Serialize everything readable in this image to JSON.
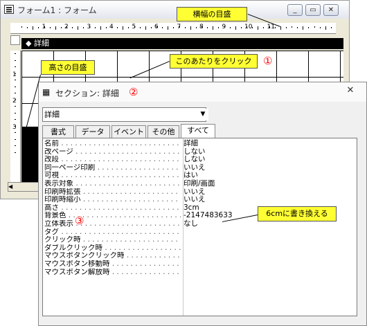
{
  "form_window": {
    "title": "フォーム1 : フォーム",
    "minimize": "_",
    "restore": "▭",
    "close": "✕",
    "ruler_digits": [
      "1",
      "2",
      "3",
      "4",
      "5",
      "6",
      "7",
      "8",
      "9",
      "10",
      "11"
    ],
    "vruler_digits": [
      "1",
      "2",
      "3"
    ],
    "section_label": "詳細"
  },
  "property_sheet": {
    "title": "セクション: 詳細",
    "close": "✕",
    "selector_value": "詳細",
    "tabs": [
      "書式",
      "データ",
      "イベント",
      "その他",
      "すべて"
    ],
    "active_tab": "すべて",
    "rows": [
      {
        "name": "名前",
        "value": "詳細"
      },
      {
        "name": "改ページ",
        "value": "しない"
      },
      {
        "name": "改段",
        "value": "しない"
      },
      {
        "name": "同一ページ印刷",
        "value": "いいえ"
      },
      {
        "name": "可視",
        "value": "はい"
      },
      {
        "name": "表示対象",
        "value": "印刷/画面"
      },
      {
        "name": "印刷時拡張",
        "value": "いいえ"
      },
      {
        "name": "印刷時縮小",
        "value": "いいえ"
      },
      {
        "name": "高さ",
        "value": "3cm"
      },
      {
        "name": "背景色",
        "value": "-2147483633"
      },
      {
        "name": "立体表示",
        "value": "なし"
      },
      {
        "name": "タグ",
        "value": ""
      },
      {
        "name": "クリック時",
        "value": ""
      },
      {
        "name": "ダブルクリック時",
        "value": ""
      },
      {
        "name": "マウスボタンクリック時",
        "value": ""
      },
      {
        "name": "マウスボタン移動時",
        "value": ""
      },
      {
        "name": "マウスボタン解放時",
        "value": ""
      }
    ]
  },
  "annotations": {
    "horizontal_ruler": "横幅の目盛",
    "vertical_ruler": "高さの目盛",
    "click_here": "このあたりをクリック",
    "rewrite": "6cmに書き換える",
    "marker_1": "①",
    "marker_2": "②",
    "marker_3": "③"
  },
  "colors": {
    "callout": "#ffff33",
    "marker": "#ff0000",
    "section_bar": "#000000"
  }
}
